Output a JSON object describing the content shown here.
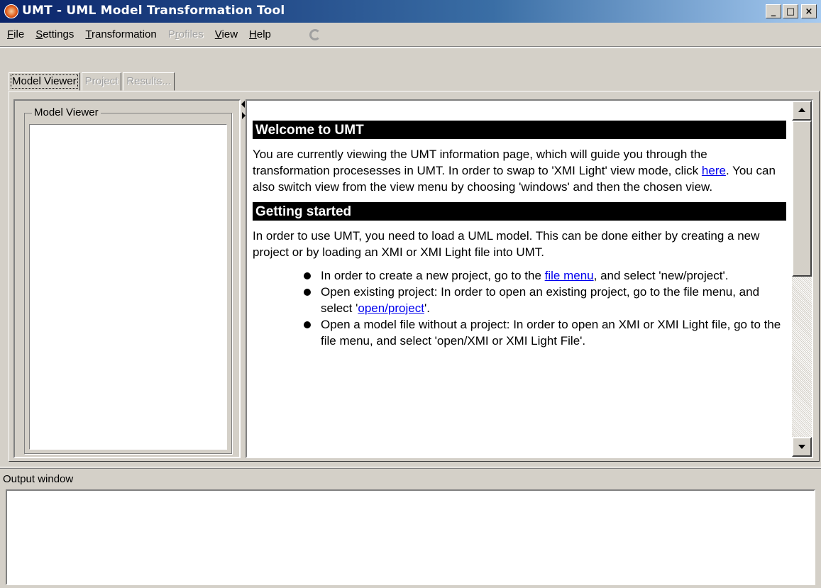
{
  "window": {
    "title": "UMT - UML Model Transformation Tool",
    "minimize": "_",
    "maximize": "□",
    "close": "×"
  },
  "menu": {
    "items": [
      {
        "underline": "F",
        "rest": "ile"
      },
      {
        "underline": "S",
        "rest": "ettings"
      },
      {
        "underline": "T",
        "rest": "ransformation"
      },
      {
        "pre": "P",
        "underline": "r",
        "rest": "ofiles"
      },
      {
        "underline": "V",
        "rest": "iew"
      },
      {
        "underline": "H",
        "rest": "elp"
      }
    ],
    "refresh_icon": "refresh-icon"
  },
  "tabs": [
    "Model Viewer",
    "Project",
    "Results..."
  ],
  "left_pane": {
    "group_title": "Model Viewer"
  },
  "content": {
    "heading1": "Welcome to UMT",
    "para1_before": "You are currently viewing the UMT information page, which will guide you through the transformation procesesses in UMT.  In order to swap to 'XMI Light' view mode, click ",
    "para1_link": "here",
    "para1_after": ". You can also switch view from the  view  menu by choosing 'windows' and then the chosen view.",
    "heading2": "Getting started",
    "para2": "In order to use UMT, you need to load a UML model. This can be done either by creating a new project or by loading an XMI or XMI Light file into UMT.",
    "bullet1_before": "In order to create a new project, go to the  ",
    "bullet1_link": "file  menu",
    "bullet1_after": ", and select 'new/project'.",
    "bullet2_before": "Open existing project: In order to open an existing project, go to the  file  menu, and select '",
    "bullet2_link": "open/project",
    "bullet2_after": "'.",
    "bullet3": "Open a model file without a project: In order to open an XMI or XMI Light file, go to the  file  menu, and select 'open/XMI or XMI Light File'."
  },
  "output": {
    "label": "Output window"
  }
}
